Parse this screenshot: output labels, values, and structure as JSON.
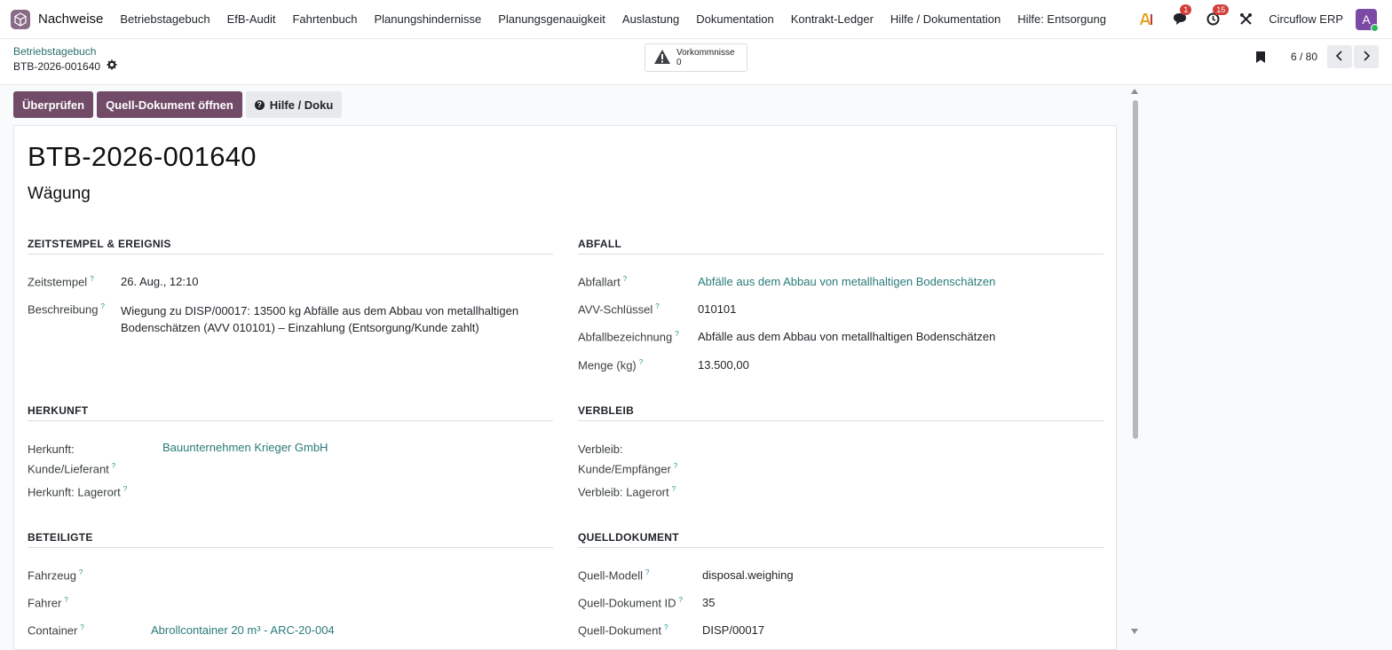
{
  "topbar": {
    "app_title": "Nachweise",
    "menu": [
      "Betriebstagebuch",
      "EfB-Audit",
      "Fahrtenbuch",
      "Planungshindernisse",
      "Planungsgenauigkeit",
      "Auslastung",
      "Dokumentation",
      "Kontrakt-Ledger",
      "Hilfe / Dokumentation",
      "Hilfe: Entsorgung"
    ],
    "messages_badge": "1",
    "activities_badge": "15",
    "company": "Circuflow ERP",
    "avatar_letter": "A"
  },
  "control": {
    "breadcrumb": "Betriebstagebuch",
    "record_name": "BTB-2026-001640",
    "incidents_label": "Vorkommnisse",
    "incidents_count": "0",
    "pager": "6 / 80"
  },
  "actions": {
    "review": "Überprüfen",
    "open_source": "Quell-Dokument öffnen",
    "help": "Hilfe / Doku"
  },
  "form": {
    "title": "BTB-2026-001640",
    "subtitle": "Wägung",
    "timestamp_group": {
      "title": "ZEITSTEMPEL & EREIGNIS",
      "timestamp_label": "Zeitstempel",
      "timestamp_value": "26. Aug., 12:10",
      "description_label": "Beschreibung",
      "description_line1": "Wiegung zu DISP/00017: 13500 kg Abfälle aus dem Abbau von metallhaltigen",
      "description_line2": "Bodenschätzen (AVV 010101) – Einzahlung (Entsorgung/Kunde zahlt)"
    },
    "waste_group": {
      "title": "ABFALL",
      "waste_type_label": "Abfallart",
      "waste_type_value": "Abfälle aus dem Abbau von metallhaltigen Bodenschätzen",
      "avv_label": "AVV-Schlüssel",
      "avv_value": "010101",
      "designation_label": "Abfallbezeichnung",
      "designation_value": "Abfälle aus dem Abbau von metallhaltigen Bodenschätzen",
      "quantity_label": "Menge (kg)",
      "quantity_value": "13.500,00"
    },
    "origin_group": {
      "title": "HERKUNFT",
      "customer_label_line1": "Herkunft:",
      "customer_label_line2": "Kunde/Lieferant",
      "customer_value": "Bauunternehmen Krieger GmbH",
      "location_label": "Herkunft: Lagerort"
    },
    "destination_group": {
      "title": "VERBLEIB",
      "customer_label_line1": "Verbleib:",
      "customer_label_line2": "Kunde/Empfänger",
      "location_label": "Verbleib: Lagerort"
    },
    "participants_group": {
      "title": "BETEILIGTE",
      "vehicle_label": "Fahrzeug",
      "driver_label": "Fahrer",
      "container_label": "Container",
      "container_value": "Abrollcontainer 20 m³ - ARC-20-004"
    },
    "source_group": {
      "title": "QUELLDOKUMENT",
      "model_label": "Quell-Modell",
      "model_value": "disposal.weighing",
      "doc_id_label": "Quell-Dokument ID",
      "doc_id_value": "35",
      "doc_label": "Quell-Dokument",
      "doc_value": "DISP/00017"
    },
    "help_marker": "?"
  },
  "colors": {
    "primary": "#714b67",
    "link": "#2a7a7a",
    "badge": "#d23f3a",
    "avatar": "#7b4aa4"
  }
}
